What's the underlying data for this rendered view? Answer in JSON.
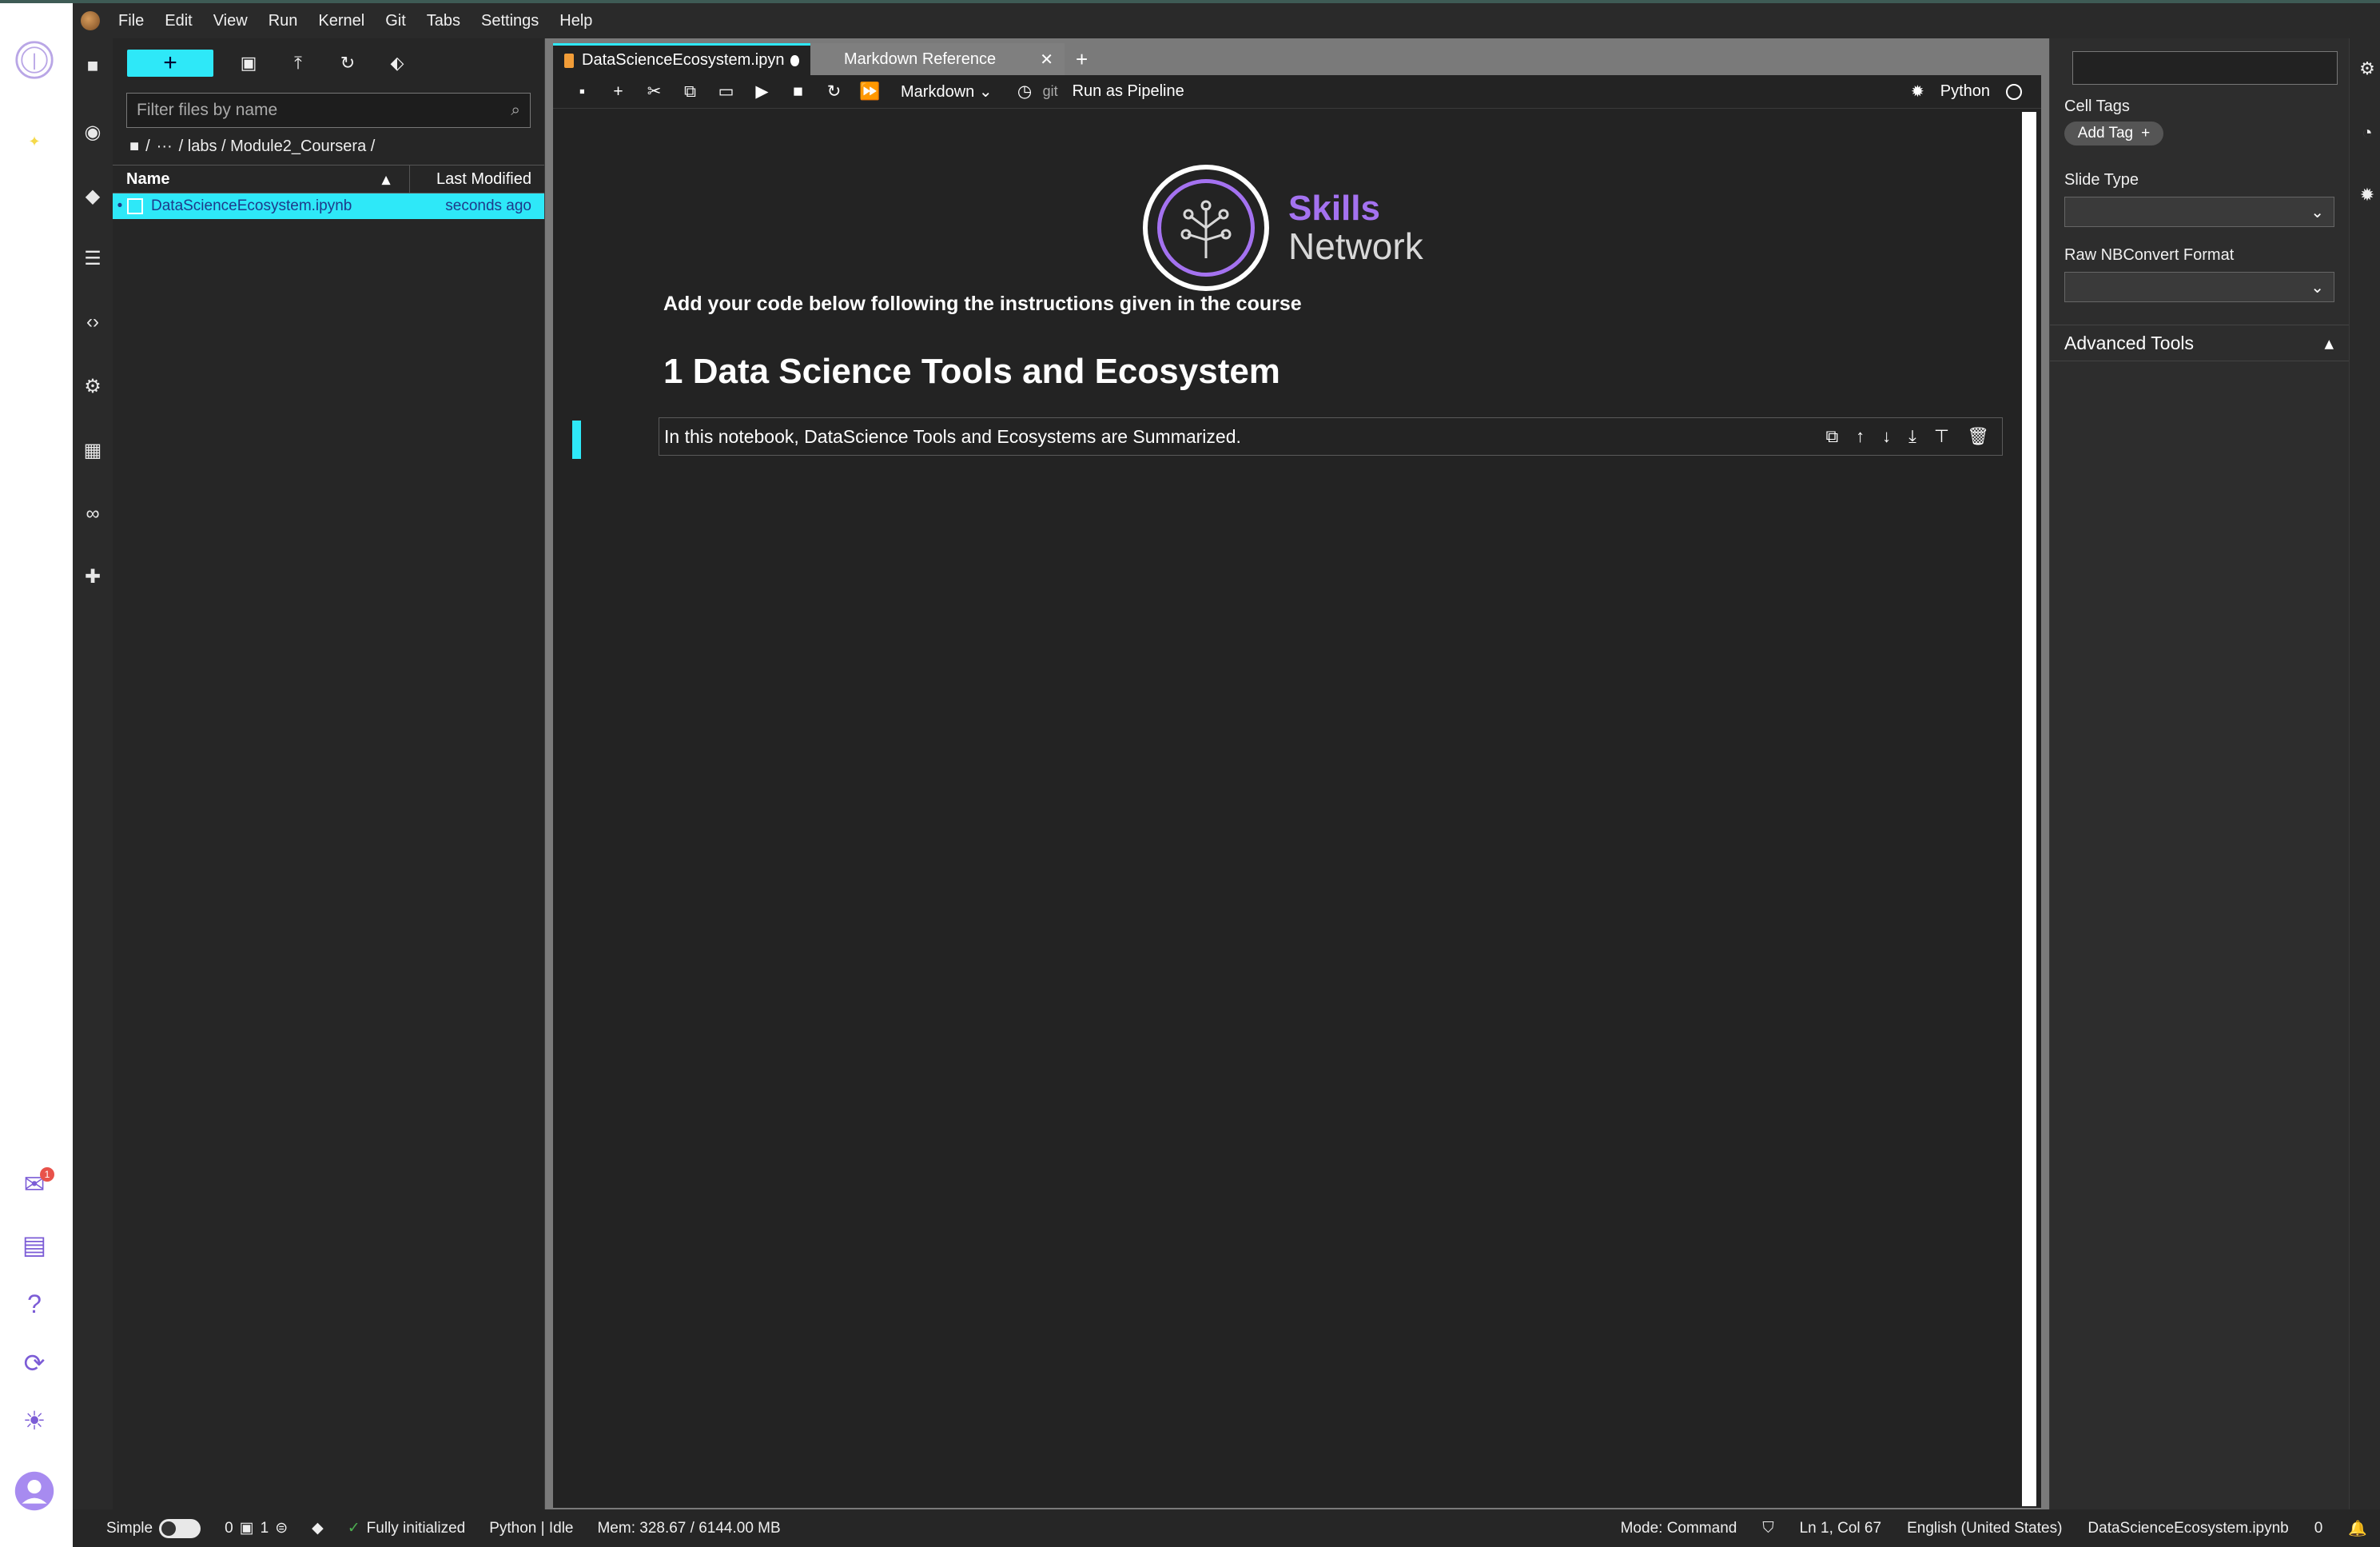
{
  "menu": [
    "File",
    "Edit",
    "View",
    "Run",
    "Kernel",
    "Git",
    "Tabs",
    "Settings",
    "Help"
  ],
  "filebrowser": {
    "new_button": "+",
    "filter_placeholder": "Filter files by name",
    "breadcrumb": [
      "/",
      "···",
      "/ labs / Module2_Coursera /"
    ],
    "col_name": "Name",
    "col_modified": "Last Modified",
    "files": [
      {
        "name": "DataScienceEcosystem.ipynb",
        "modified": "seconds ago"
      }
    ]
  },
  "tabs": [
    {
      "label": "DataScienceEcosystem.ipyn",
      "active": true
    },
    {
      "label": "Markdown Reference",
      "active": false
    }
  ],
  "tab_add": "+",
  "toolbar": {
    "cell_type": "Markdown",
    "git": "git",
    "pipeline": "Run as Pipeline",
    "kernel": "Python"
  },
  "notebook": {
    "brand_skills": "Skills",
    "brand_network": "Network",
    "instructions": "Add your code below following the instructions given in the course",
    "heading": "1 Data Science Tools and Ecosystem",
    "cell_text": "In this notebook, DataScience Tools and Ecosystems are Summarized."
  },
  "rightpanel": {
    "cell_tags_label": "Cell Tags",
    "add_tag": "Add Tag",
    "slide_type_label": "Slide Type",
    "raw_format_label": "Raw NBConvert Format",
    "advanced_tools": "Advanced Tools"
  },
  "statusbar": {
    "simple": "Simple",
    "count0": "0",
    "count1": "1",
    "init": "Fully initialized",
    "kernel_status": "Python | Idle",
    "mem": "Mem: 328.67 / 6144.00 MB",
    "mode": "Mode: Command",
    "position": "Ln 1, Col 67",
    "language": "English (United States)",
    "filename": "DataScienceEcosystem.ipynb",
    "notif_count": "0"
  },
  "notification_badge": "1",
  "colors": {
    "accent": "#2ee8f8",
    "brand_purple": "#a472f0"
  }
}
